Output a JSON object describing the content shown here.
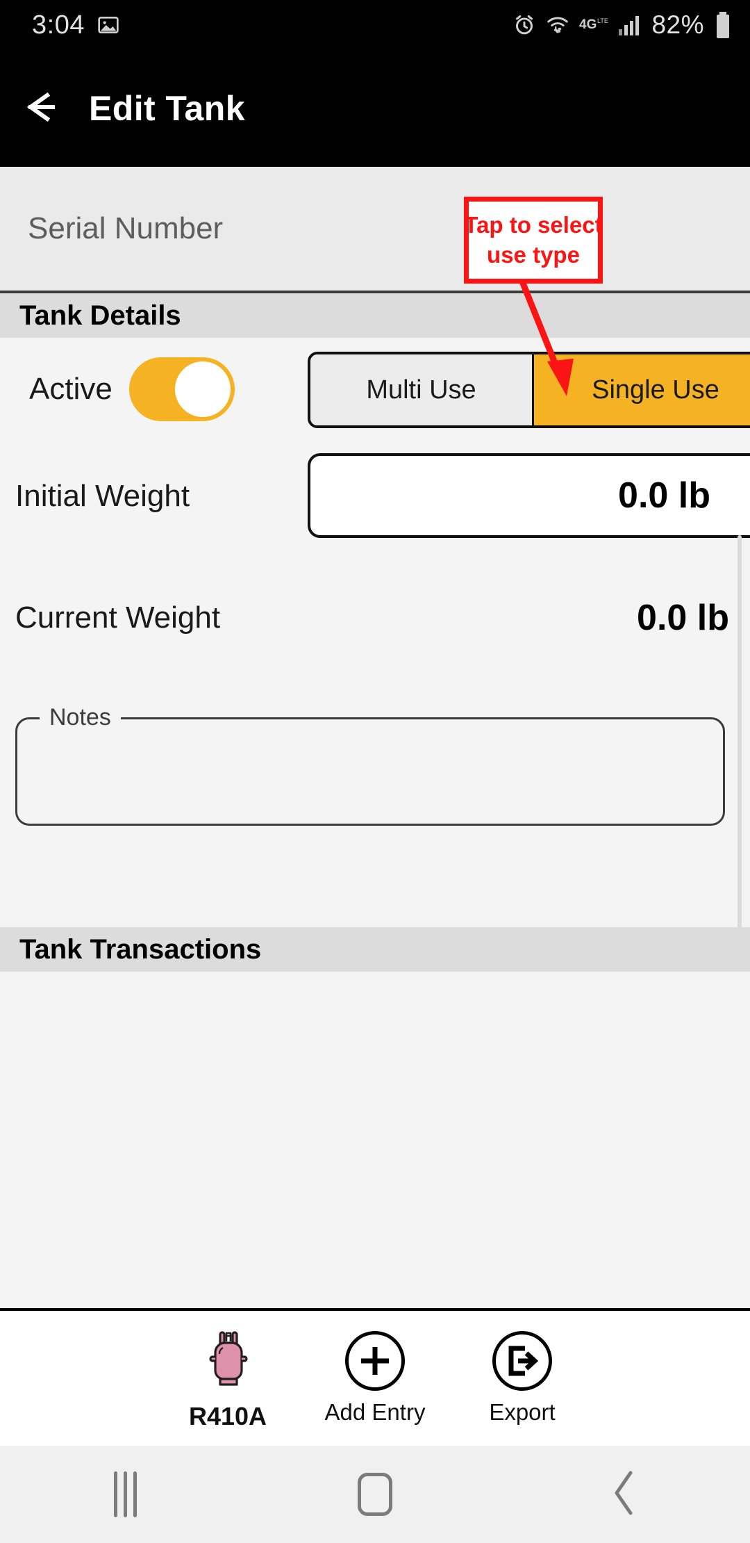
{
  "status_bar": {
    "time": "3:04",
    "battery_percent": "82%",
    "icons": [
      "image-icon",
      "alarm-icon",
      "wifi-icon",
      "network-4g-lte-icon",
      "signal-bars-icon",
      "battery-icon"
    ]
  },
  "app_bar": {
    "title": "Edit Tank",
    "back_icon": "arrow-left-icon"
  },
  "form": {
    "serial_number_placeholder": "Serial Number",
    "serial_number_value": "",
    "tank_details_header": "Tank Details",
    "active_label": "Active",
    "active_on": true,
    "use_type": {
      "options": [
        "Multi Use",
        "Single Use"
      ],
      "selected": "Single Use"
    },
    "initial_weight_label": "Initial Weight",
    "initial_weight_value": "0.0 lb",
    "current_weight_label": "Current Weight",
    "current_weight_value": "0.0 lb",
    "notes_label": "Notes",
    "notes_value": "",
    "tank_transactions_header": "Tank Transactions"
  },
  "annotation": {
    "line1": "Tap to select",
    "line2": "use type",
    "color": "#fb1414"
  },
  "bottom_bar": {
    "items": [
      {
        "label": "R410A",
        "icon": "refrigerant-tank-icon"
      },
      {
        "label": "Add Entry",
        "icon": "plus-circle-icon"
      },
      {
        "label": "Export",
        "icon": "export-circle-icon"
      }
    ]
  },
  "nav_bar": {
    "recents": "recents-icon",
    "home": "home-icon",
    "back": "back-chevron-icon"
  },
  "colors": {
    "accent": "#f5b324",
    "annotation": "#fb1414",
    "tank_pink": "#dd91ab",
    "section_header_bg": "#dcdcdc",
    "page_bg": "#f4f4f4"
  }
}
